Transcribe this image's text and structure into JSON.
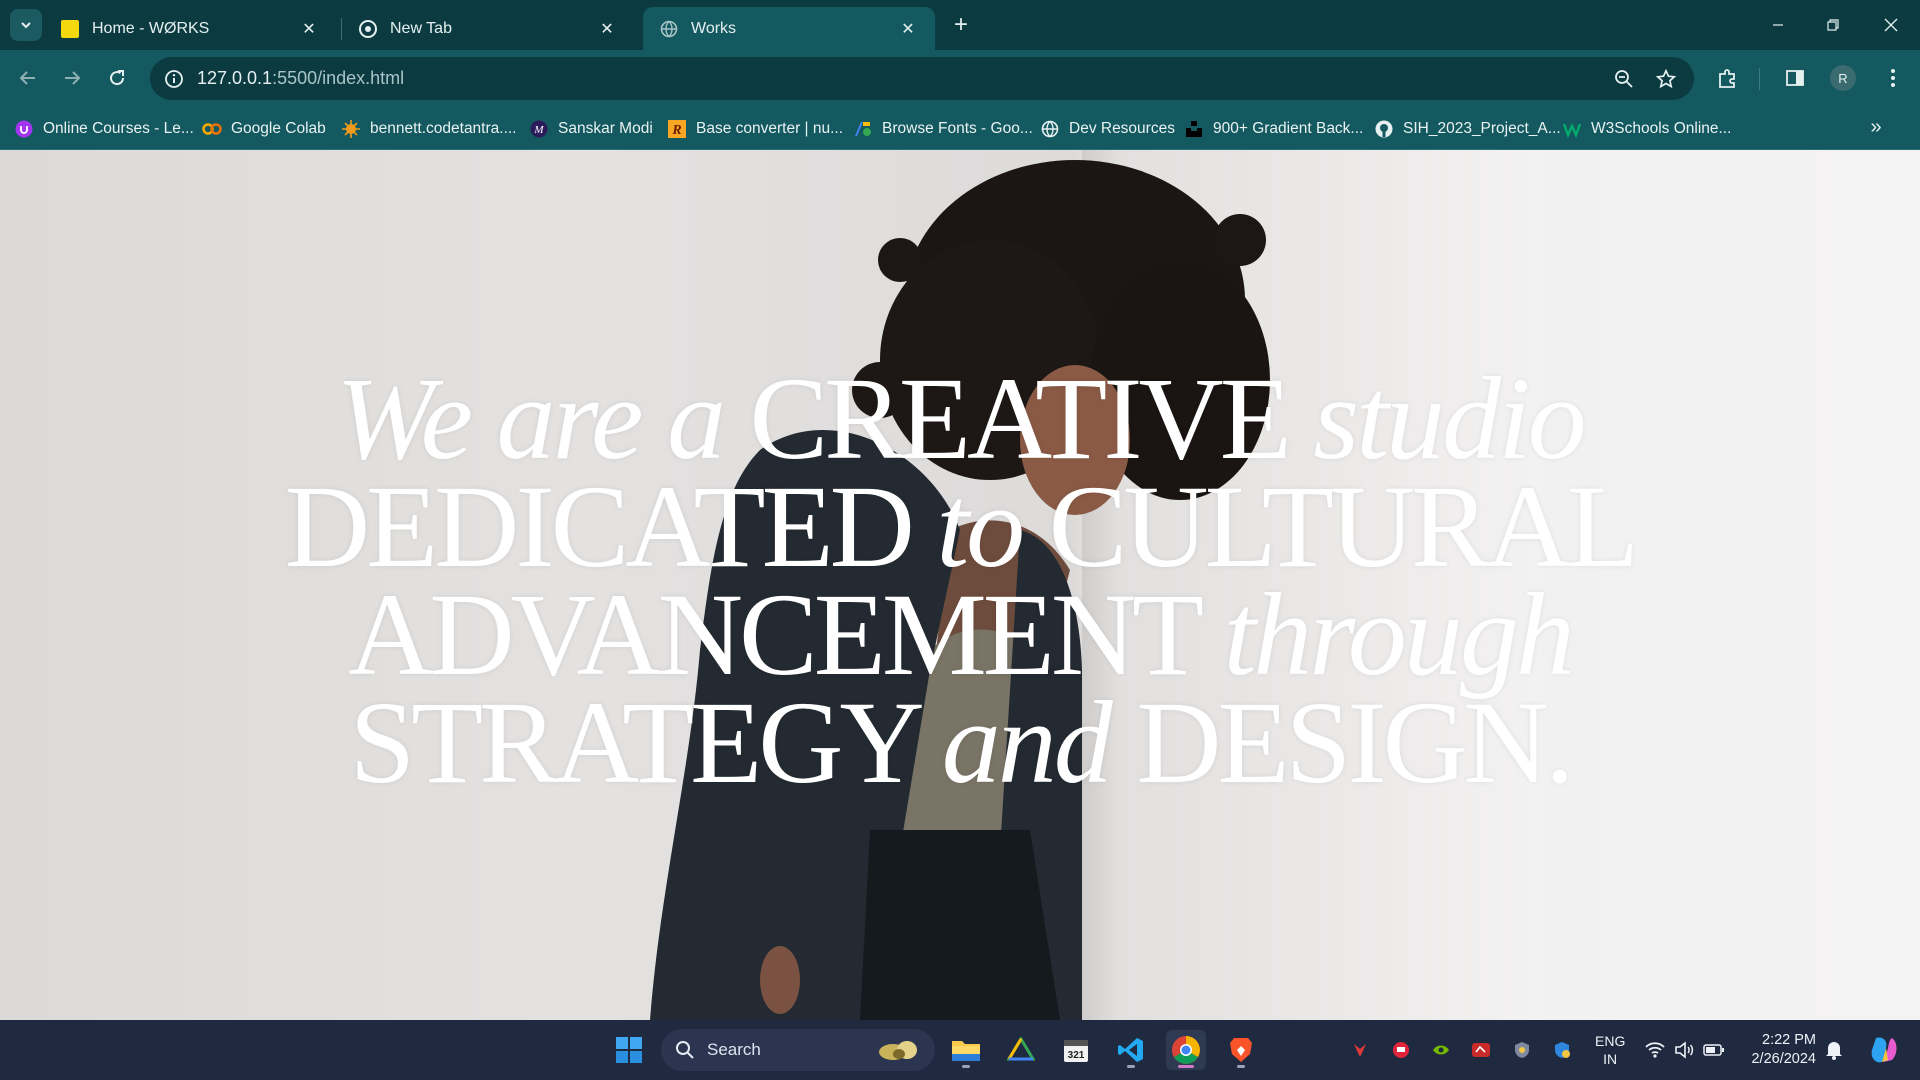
{
  "browser": {
    "tabs": [
      {
        "title": "Home - WØRKS",
        "active": false,
        "favicon": "yellow-square-icon"
      },
      {
        "title": "New Tab",
        "active": false,
        "favicon": "chrome-icon"
      },
      {
        "title": "Works",
        "active": true,
        "favicon": "globe-icon"
      }
    ],
    "address": {
      "host": "127.0.0.1",
      "path": ":5500/index.html"
    },
    "bookmarks": [
      {
        "label": "Online Courses - Le...",
        "icon": "udemy-icon"
      },
      {
        "label": "Google Colab",
        "icon": "colab-icon"
      },
      {
        "label": "bennett.codetantra....",
        "icon": "codetantra-icon"
      },
      {
        "label": "Sanskar Modi",
        "icon": "portfolio-icon"
      },
      {
        "label": "Base converter | nu...",
        "icon": "rapidtables-icon"
      },
      {
        "label": "Browse Fonts - Goo...",
        "icon": "google-fonts-icon"
      },
      {
        "label": "Dev Resources",
        "icon": "globe-icon"
      },
      {
        "label": "900+ Gradient Back...",
        "icon": "unsplash-icon"
      },
      {
        "label": "SIH_2023_Project_A...",
        "icon": "github-icon"
      },
      {
        "label": "W3Schools Online...",
        "icon": "w3schools-icon"
      }
    ],
    "profile_initial": "R"
  },
  "page": {
    "headline": [
      {
        "parts": [
          {
            "t": "We are a ",
            "i": true
          },
          {
            "t": "CREATIVE ",
            "i": false
          },
          {
            "t": "studio",
            "i": true
          }
        ]
      },
      {
        "parts": [
          {
            "t": "DEDICATED ",
            "i": false
          },
          {
            "t": "to ",
            "i": true
          },
          {
            "t": "CULTURAL",
            "i": false
          }
        ]
      },
      {
        "parts": [
          {
            "t": "ADVANCEMENT ",
            "i": false
          },
          {
            "t": "through",
            "i": true
          }
        ]
      },
      {
        "parts": [
          {
            "t": "STRATEGY ",
            "i": false
          },
          {
            "t": "and ",
            "i": true
          },
          {
            "t": "DESIGN.",
            "i": false
          }
        ]
      }
    ]
  },
  "taskbar": {
    "search_label": "Search",
    "language": {
      "top": "ENG",
      "bottom": "IN"
    },
    "time": "2:22 PM",
    "date": "2/26/2024"
  },
  "colors": {
    "browser_frame": "#0b3b41",
    "browser_toolbar": "#13595f",
    "taskbar": "#1f2a40",
    "headline": "#ffffff"
  }
}
